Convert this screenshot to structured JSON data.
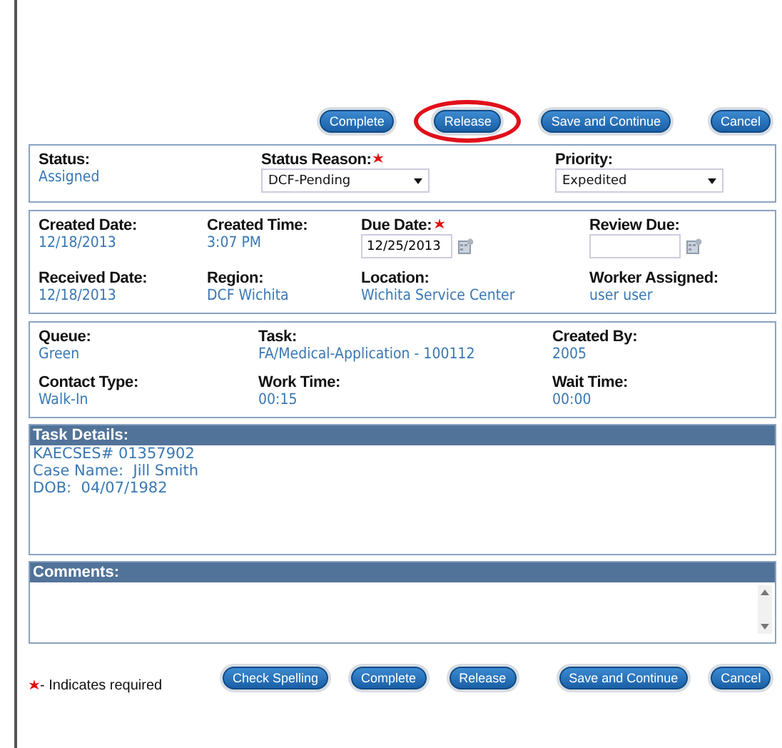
{
  "top_buttons": [
    {
      "label": "Complete",
      "circled": false
    },
    {
      "label": "Release",
      "circled": true
    },
    {
      "label": "Save and Continue",
      "circled": false
    },
    {
      "label": "Cancel",
      "circled": false
    }
  ],
  "sections": [
    {
      "fields": [
        {
          "kind": "text",
          "label": "Status:",
          "value": "Assigned",
          "required": false
        },
        {
          "kind": "select",
          "label": "Status Reason:",
          "value": "DCF-Pending",
          "required": true
        },
        {
          "kind": "select",
          "label": "Priority:",
          "value": "Expedited",
          "required": false
        }
      ]
    },
    {
      "fields": [
        {
          "kind": "text",
          "label": "Created Date:",
          "value": "12/18/2013",
          "required": false
        },
        {
          "kind": "text",
          "label": "Created Time:",
          "value": "3:07 PM",
          "required": false
        },
        {
          "kind": "date",
          "label": "Due Date:",
          "value": "12/25/2013",
          "required": true
        },
        {
          "kind": "date",
          "label": "Review Due:",
          "required": false
        },
        {
          "kind": "text",
          "label": "Received Date:",
          "value": "12/18/2013",
          "required": false
        },
        {
          "kind": "text",
          "label": "Region:",
          "value": "DCF Wichita",
          "required": false
        },
        {
          "kind": "text",
          "label": "Location:",
          "value": "Wichita Service Center",
          "required": false
        },
        {
          "kind": "text",
          "label": "Worker Assigned:",
          "value": "user user",
          "required": false
        }
      ]
    },
    {
      "fields": [
        {
          "kind": "text",
          "label": "Queue:",
          "value": "Green",
          "required": false
        },
        {
          "kind": "text",
          "label": "Task:",
          "value": "FA/Medical-Application - 100112",
          "required": false
        },
        {
          "kind": "text",
          "label": "Created By:",
          "value": "2005",
          "required": false
        },
        {
          "kind": "text",
          "label": "Contact Type:",
          "value": "Walk-In",
          "required": false
        },
        {
          "kind": "text",
          "label": "Work Time:",
          "value": "00:15",
          "required": false
        },
        {
          "kind": "text",
          "label": "Wait Time:",
          "value": "00:00",
          "required": false
        }
      ]
    }
  ],
  "task_details": {
    "title": "Task Details:",
    "lines": [
      "KAECSES# 01357902",
      "Case Name:  Jill Smith",
      "DOB:  04/07/1982"
    ]
  },
  "comments": {
    "title": "Comments:"
  },
  "legend": {
    "text": "- Indicates required"
  },
  "bottom_buttons": [
    {
      "label": "Check Spelling"
    },
    {
      "label": "Complete"
    },
    {
      "label": "Release"
    },
    {
      "label": "Save and Continue"
    },
    {
      "label": "Cancel"
    }
  ]
}
